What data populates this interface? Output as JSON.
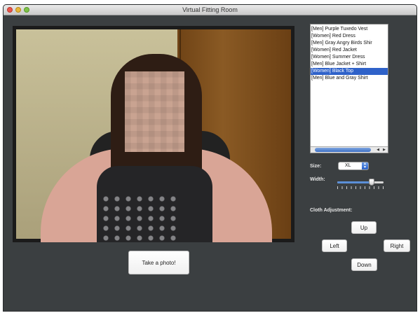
{
  "window": {
    "title": "Virtual Fitting Room"
  },
  "clothes": [
    {
      "label": "[Men]   Purple Tuxedo Vest",
      "selected": false
    },
    {
      "label": "[Women] Red Dress",
      "selected": false
    },
    {
      "label": "[Men]   Gray Angry Birds Shir",
      "selected": false
    },
    {
      "label": "[Women] Red Jacket",
      "selected": false
    },
    {
      "label": "[Women] Summer Dress",
      "selected": false
    },
    {
      "label": "[Men]   Blue Jacket + Shirt",
      "selected": false
    },
    {
      "label": "[Women] Black Top",
      "selected": true
    },
    {
      "label": "[Men]   Blue and Gray Shirt",
      "selected": false
    }
  ],
  "controls": {
    "size_label": "Size:",
    "size_value": "XL",
    "width_label": "Width:",
    "width_level": 0.78,
    "cloth_adjustment_label": "Cloth Adjustment:",
    "up_label": "Up",
    "left_label": "Left",
    "right_label": "Right",
    "down_label": "Down"
  },
  "camera": {
    "photo_button_label": "Take a photo!"
  }
}
